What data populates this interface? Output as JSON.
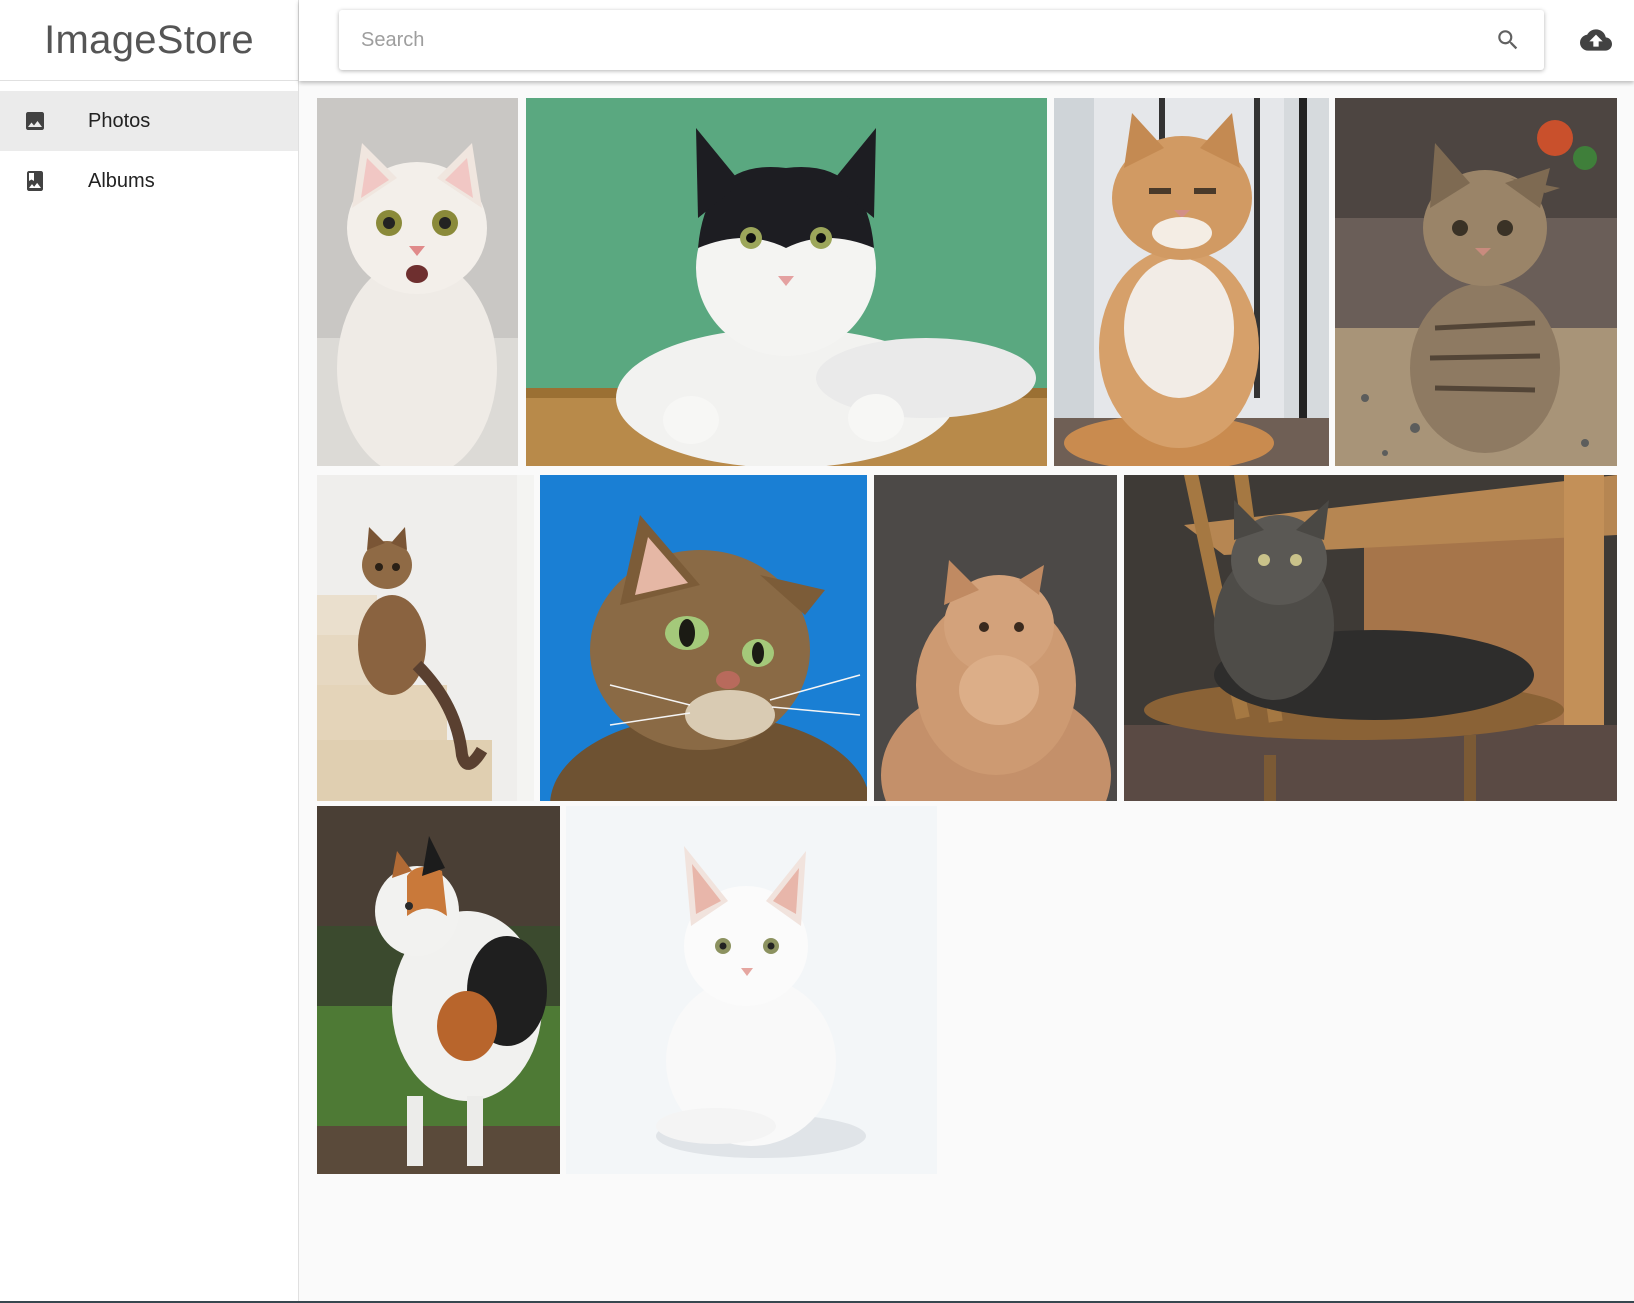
{
  "app": {
    "title": "ImageStore"
  },
  "sidebar": {
    "items": [
      {
        "label": "Photos",
        "icon": "photo-icon",
        "active": true
      },
      {
        "label": "Albums",
        "icon": "photo-album-icon",
        "active": false
      }
    ]
  },
  "header": {
    "search": {
      "placeholder": "Search",
      "value": ""
    },
    "search_icon": "search-icon",
    "upload_icon": "cloud-upload-icon"
  },
  "photos": [
    {
      "name": "white kitten meowing"
    },
    {
      "name": "black and white cat on green background"
    },
    {
      "name": "orange persian cat by window"
    },
    {
      "name": "tabby kitten on terrazzo floor"
    },
    {
      "name": "tabby cat on stairs"
    },
    {
      "name": "tabby cat on blue background"
    },
    {
      "name": "fluffy ginger cat"
    },
    {
      "name": "grey tabby cat on chair"
    },
    {
      "name": "calico cat in grass"
    },
    {
      "name": "white kitten on white background"
    }
  ],
  "colors": {
    "sidebar_active": "#ebebeb",
    "icon": "#424242",
    "page_background": "#fafafa"
  }
}
